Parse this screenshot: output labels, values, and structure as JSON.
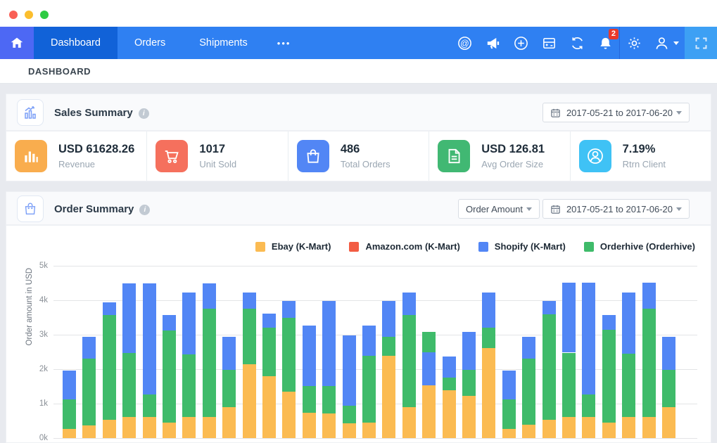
{
  "window": {
    "traffic_lights": [
      "#f95f56",
      "#fbbe2e",
      "#2ecb43"
    ]
  },
  "navbar": {
    "background": "#2f80f2",
    "active_background": "#1162d8",
    "tabs": [
      {
        "label": "Dashboard",
        "active": true
      },
      {
        "label": "Orders",
        "active": false
      },
      {
        "label": "Shipments",
        "active": false
      }
    ],
    "more_label": "•••",
    "icons": [
      "at-circle",
      "megaphone",
      "plus-circle",
      "calculator",
      "sync",
      "bell",
      "gear",
      "user",
      "fullscreen"
    ],
    "notification_count": "2"
  },
  "breadcrumb": "DASHBOARD",
  "sales_summary": {
    "title": "Sales Summary",
    "date_range": "2017-05-21 to 2017-06-20",
    "cards": [
      {
        "value": "USD 61628.26",
        "label": "Revenue",
        "icon": "bar-chart",
        "color": "#f9ad4e"
      },
      {
        "value": "1017",
        "label": "Unit Sold",
        "icon": "cart",
        "color": "#f5705d"
      },
      {
        "value": "486",
        "label": "Total Orders",
        "icon": "shopping-bag",
        "color": "#5286f5"
      },
      {
        "value": "USD 126.81",
        "label": "Avg Order Size",
        "icon": "document",
        "color": "#41b873"
      },
      {
        "value": "7.19%",
        "label": "Rtrn Client",
        "icon": "user-circle",
        "color": "#3fc2f5"
      }
    ]
  },
  "order_summary": {
    "title": "Order Summary",
    "metric_dropdown": "Order Amount",
    "date_range": "2017-05-21 to 2017-06-20"
  },
  "chart_data": {
    "type": "bar",
    "stacked": true,
    "title": "Order Summary",
    "ylabel": "Order amount in USD",
    "ylim": [
      0,
      5000
    ],
    "grid": true,
    "legend_position": "top-right",
    "y_axis": {
      "max": 5000,
      "ticks": [
        {
          "label": "5k",
          "value": 5000
        },
        {
          "label": "4k",
          "value": 4000
        },
        {
          "label": "3k",
          "value": 3000
        },
        {
          "label": "2k",
          "value": 2000
        },
        {
          "label": "1k",
          "value": 1000
        },
        {
          "label": "0k",
          "value": 0
        }
      ]
    },
    "legend": [
      {
        "series": "ebay",
        "label": "Ebay (K-Mart)",
        "color": "#fbbb52"
      },
      {
        "series": "amazon",
        "label": "Amazon.com (K-Mart)",
        "color": "#f25c43"
      },
      {
        "series": "shopify",
        "label": "Shopify (K-Mart)",
        "color": "#5286f5"
      },
      {
        "series": "orderhive",
        "label": "Orderhive (Orderhive)",
        "color": "#3fbb6a"
      }
    ],
    "series_colors": {
      "ebay": "#fbbb52",
      "amazon": "#f25c43",
      "shopify": "#5286f5",
      "orderhive": "#3fbb6a"
    },
    "note": "31 daily bars; amazon series is 0 in all visible bars; stacks listed bottom-to-top in USD",
    "bars": [
      {
        "stack": [
          [
            "ebay",
            260
          ],
          [
            "orderhive",
            860
          ],
          [
            "shopify",
            830
          ]
        ]
      },
      {
        "stack": [
          [
            "ebay",
            360
          ],
          [
            "orderhive",
            1940
          ],
          [
            "shopify",
            630
          ]
        ]
      },
      {
        "stack": [
          [
            "ebay",
            530
          ],
          [
            "orderhive",
            3050
          ],
          [
            "shopify",
            360
          ]
        ]
      },
      {
        "stack": [
          [
            "ebay",
            620
          ],
          [
            "orderhive",
            1850
          ],
          [
            "shopify",
            2030
          ]
        ]
      },
      {
        "stack": [
          [
            "ebay",
            620
          ],
          [
            "orderhive",
            640
          ],
          [
            "shopify",
            3240
          ]
        ]
      },
      {
        "stack": [
          [
            "ebay",
            440
          ],
          [
            "orderhive",
            2690
          ],
          [
            "shopify",
            450
          ]
        ]
      },
      {
        "stack": [
          [
            "ebay",
            620
          ],
          [
            "orderhive",
            1810
          ],
          [
            "shopify",
            1800
          ]
        ]
      },
      {
        "stack": [
          [
            "ebay",
            620
          ],
          [
            "orderhive",
            3130
          ],
          [
            "shopify",
            750
          ]
        ]
      },
      {
        "stack": [
          [
            "ebay",
            900
          ],
          [
            "orderhive",
            1070
          ],
          [
            "shopify",
            960
          ]
        ]
      },
      {
        "stack": [
          [
            "ebay",
            2140
          ],
          [
            "orderhive",
            1610
          ],
          [
            "shopify",
            480
          ]
        ]
      },
      {
        "stack": [
          [
            "ebay",
            1790
          ],
          [
            "orderhive",
            1420
          ],
          [
            "shopify",
            410
          ]
        ]
      },
      {
        "stack": [
          [
            "ebay",
            1340
          ],
          [
            "orderhive",
            2160
          ],
          [
            "shopify",
            470
          ]
        ]
      },
      {
        "stack": [
          [
            "ebay",
            730
          ],
          [
            "orderhive",
            780
          ],
          [
            "shopify",
            1750
          ]
        ]
      },
      {
        "stack": [
          [
            "ebay",
            720
          ],
          [
            "orderhive",
            790
          ],
          [
            "shopify",
            2460
          ]
        ]
      },
      {
        "stack": [
          [
            "ebay",
            420
          ],
          [
            "orderhive",
            510
          ],
          [
            "shopify",
            2050
          ]
        ]
      },
      {
        "stack": [
          [
            "ebay",
            450
          ],
          [
            "orderhive",
            1940
          ],
          [
            "shopify",
            870
          ]
        ]
      },
      {
        "stack": [
          [
            "ebay",
            2390
          ],
          [
            "orderhive",
            550
          ],
          [
            "shopify",
            1030
          ]
        ]
      },
      {
        "stack": [
          [
            "ebay",
            900
          ],
          [
            "orderhive",
            2680
          ],
          [
            "shopify",
            650
          ]
        ]
      },
      {
        "stack": [
          [
            "ebay",
            1530
          ],
          [
            "shopify",
            950
          ],
          [
            "orderhive",
            610
          ]
        ]
      },
      {
        "stack": [
          [
            "ebay",
            1390
          ],
          [
            "orderhive",
            360
          ],
          [
            "shopify",
            610
          ]
        ]
      },
      {
        "stack": [
          [
            "ebay",
            1230
          ],
          [
            "orderhive",
            740
          ],
          [
            "shopify",
            1120
          ]
        ]
      },
      {
        "stack": [
          [
            "ebay",
            2620
          ],
          [
            "orderhive",
            590
          ],
          [
            "shopify",
            1020
          ]
        ]
      },
      {
        "stack": [
          [
            "ebay",
            260
          ],
          [
            "orderhive",
            870
          ],
          [
            "shopify",
            820
          ]
        ]
      },
      {
        "stack": [
          [
            "ebay",
            390
          ],
          [
            "orderhive",
            1920
          ],
          [
            "shopify",
            630
          ]
        ]
      },
      {
        "stack": [
          [
            "ebay",
            540
          ],
          [
            "orderhive",
            3060
          ],
          [
            "shopify",
            380
          ]
        ]
      },
      {
        "stack": [
          [
            "ebay",
            620
          ],
          [
            "orderhive",
            1860
          ],
          [
            "shopify",
            2040
          ]
        ]
      },
      {
        "stack": [
          [
            "ebay",
            620
          ],
          [
            "orderhive",
            640
          ],
          [
            "shopify",
            3260
          ]
        ]
      },
      {
        "stack": [
          [
            "ebay",
            450
          ],
          [
            "orderhive",
            2700
          ],
          [
            "shopify",
            430
          ]
        ]
      },
      {
        "stack": [
          [
            "ebay",
            610
          ],
          [
            "orderhive",
            1840
          ],
          [
            "shopify",
            1780
          ]
        ]
      },
      {
        "stack": [
          [
            "ebay",
            610
          ],
          [
            "orderhive",
            3140
          ],
          [
            "shopify",
            770
          ]
        ]
      },
      {
        "stack": [
          [
            "ebay",
            890
          ],
          [
            "orderhive",
            1080
          ],
          [
            "shopify",
            970
          ]
        ]
      }
    ]
  }
}
